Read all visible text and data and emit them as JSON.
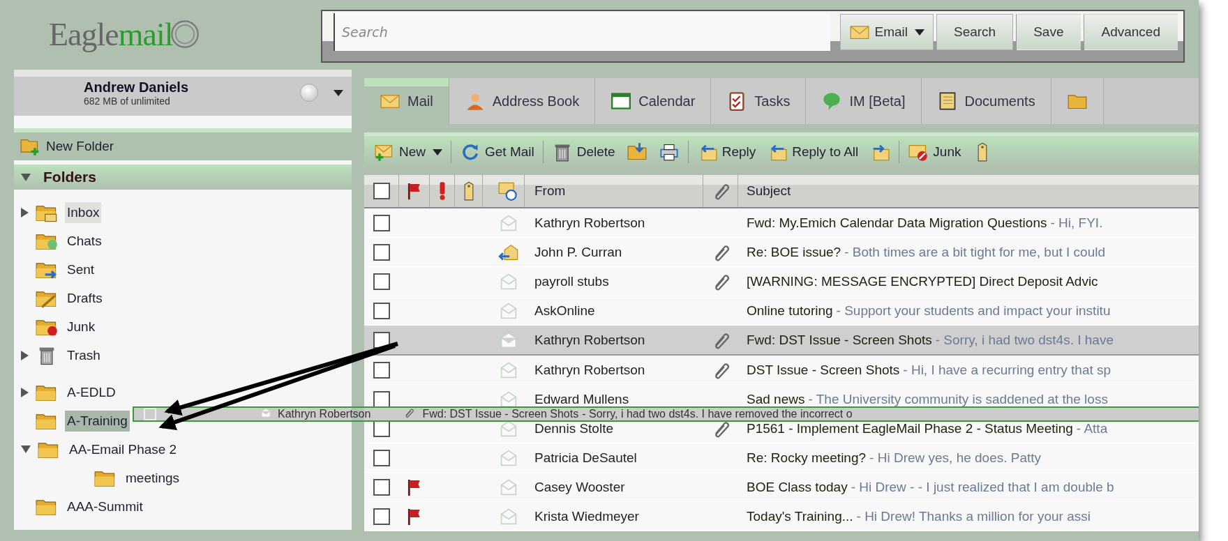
{
  "logo": {
    "dark": "Eagle",
    "green": "mail"
  },
  "search": {
    "placeholder": "Search",
    "scope": "Email",
    "buttons": [
      "Search",
      "Save",
      "Advanced"
    ]
  },
  "account": {
    "name": "Andrew Daniels",
    "quota": "682 MB of unlimited"
  },
  "new_folder": "New Folder",
  "folders_header": {
    "label": "Folders",
    "expanded": true
  },
  "folders": [
    {
      "label": "Inbox",
      "kind": "inbox",
      "expanded": false,
      "selected": true,
      "drop_target": false
    },
    {
      "label": "Chats",
      "kind": "chats",
      "selected": false,
      "drop_target": false
    },
    {
      "label": "Sent",
      "kind": "sent",
      "selected": false,
      "drop_target": false
    },
    {
      "label": "Drafts",
      "kind": "drafts",
      "selected": false,
      "drop_target": false
    },
    {
      "label": "Junk",
      "kind": "junk",
      "selected": false,
      "drop_target": false
    },
    {
      "label": "Trash",
      "kind": "trash",
      "expanded": false,
      "selected": false,
      "drop_target": false
    }
  ],
  "custom_folders": [
    {
      "label": "A-EDLD",
      "kind": "folder",
      "expanded": false,
      "selected": false,
      "drop_target": false
    },
    {
      "label": "A-Training",
      "kind": "folder",
      "selected": false,
      "drop_target": true
    },
    {
      "label": "AA-Email Phase 2",
      "kind": "folder",
      "expanded": true,
      "selected": false,
      "drop_target": false,
      "children": [
        {
          "label": "meetings",
          "kind": "folder",
          "selected": false,
          "drop_target": false
        }
      ]
    },
    {
      "label": "AAA-Summit",
      "kind": "folder",
      "selected": false,
      "drop_target": false
    }
  ],
  "tabs": [
    {
      "label": "Mail",
      "kind": "mail",
      "selected": true
    },
    {
      "label": "Address Book",
      "kind": "person",
      "selected": false
    },
    {
      "label": "Calendar",
      "kind": "calendar",
      "selected": false
    },
    {
      "label": "Tasks",
      "kind": "tasks",
      "selected": false
    },
    {
      "label": "IM [Beta]",
      "kind": "chat",
      "selected": false
    },
    {
      "label": "Documents",
      "kind": "notebook",
      "selected": false
    },
    {
      "kind": "folder",
      "selected": false
    }
  ],
  "toolbar": [
    {
      "kind": "new",
      "label": "New",
      "dropdown": true
    },
    {
      "kind": "sep"
    },
    {
      "kind": "refresh",
      "label": "Get Mail"
    },
    {
      "kind": "sep"
    },
    {
      "kind": "trash",
      "label": "Delete"
    },
    {
      "kind": "move"
    },
    {
      "kind": "print"
    },
    {
      "kind": "sep"
    },
    {
      "kind": "reply",
      "label": "Reply"
    },
    {
      "kind": "replyall",
      "label": "Reply to All"
    },
    {
      "kind": "forward"
    },
    {
      "kind": "sep"
    },
    {
      "kind": "junk",
      "label": "Junk"
    },
    {
      "kind": "tag"
    }
  ],
  "columns": [
    {
      "kind": "check",
      "checked": false
    },
    {
      "kind": "flag"
    },
    {
      "kind": "priority"
    },
    {
      "kind": "tag"
    },
    {
      "kind": "status"
    },
    {
      "kind": "text",
      "label": "From"
    },
    {
      "kind": "attach"
    },
    {
      "kind": "text",
      "label": "Subject"
    }
  ],
  "messages": [
    {
      "from": "Kathryn Robertson",
      "subject": "Fwd: My.Emich Calendar Data Migration Questions",
      "preview": "- Hi, FYI.",
      "replied": false,
      "attachment": false,
      "flagged": false,
      "selected": false,
      "checked": false
    },
    {
      "from": "John P. Curran",
      "subject": "Re: BOE issue?",
      "preview": "- Both times are a bit tight for me, but I could",
      "replied": true,
      "attachment": true,
      "flagged": false,
      "selected": false,
      "checked": false
    },
    {
      "from": "payroll stubs",
      "subject": "[WARNING: MESSAGE ENCRYPTED] Direct Deposit Advic",
      "replied": false,
      "attachment": true,
      "flagged": false,
      "selected": false,
      "checked": false
    },
    {
      "from": "AskOnline",
      "subject": "Online tutoring",
      "preview": "- Support your students and impact your institu",
      "replied": false,
      "attachment": false,
      "flagged": false,
      "selected": false,
      "checked": false
    },
    {
      "from": "Kathryn Robertson",
      "subject": "Fwd: DST Issue - Screen Shots",
      "preview": "- Sorry, i had two dst4s. I have",
      "replied": false,
      "attachment": true,
      "flagged": false,
      "selected": true,
      "checked": false
    },
    {
      "from": "Kathryn Robertson",
      "subject": "DST Issue - Screen Shots",
      "preview": "- Hi, I have a recurring entry that sp",
      "replied": false,
      "attachment": true,
      "flagged": false,
      "selected": false,
      "checked": false
    },
    {
      "from": "Edward Mullens",
      "subject": "Sad news",
      "preview": "- The University community is saddened at the loss",
      "replied": false,
      "attachment": false,
      "flagged": false,
      "selected": false,
      "checked": false
    },
    {
      "from": "Dennis Stolte",
      "subject": "P1561 - Implement EagleMail Phase 2 - Status Meeting",
      "preview": "- Atta",
      "replied": false,
      "attachment": true,
      "flagged": false,
      "selected": false,
      "checked": false
    },
    {
      "from": "Patricia DeSautel",
      "subject": "Re: Rocky meeting?",
      "preview": "- Hi Drew yes, he does. Patty",
      "replied": false,
      "attachment": false,
      "flagged": false,
      "selected": false,
      "checked": false
    },
    {
      "from": "Casey Wooster",
      "subject": "BOE Class today",
      "preview": "- Hi Drew - - I just realized that I am double b",
      "replied": false,
      "attachment": false,
      "flagged": true,
      "selected": false,
      "checked": false
    },
    {
      "from": "Krista Wiedmeyer",
      "subject": "Today's Training...",
      "preview": "- Hi Drew! Thanks a million for your assi",
      "replied": false,
      "attachment": false,
      "flagged": true,
      "selected": false,
      "checked": false
    }
  ],
  "drag_ghost": {
    "from": "Kathryn Robertson",
    "subject": "Fwd: DST Issue - Screen Shots",
    "preview": "- Sorry, i had two dst4s. I have removed the incorrect o",
    "attachment": true
  }
}
